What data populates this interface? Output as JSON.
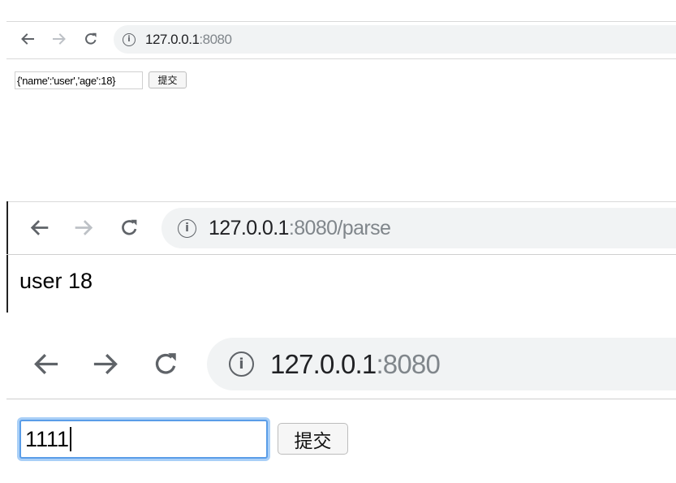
{
  "panel1": {
    "url_host": "127.0.0.1",
    "url_rest": ":8080",
    "input_value": "{'name':'user','age':18}",
    "submit_label": "提交"
  },
  "panel2": {
    "url_host": "127.0.0.1",
    "url_rest": ":8080/parse",
    "response_text": "user 18"
  },
  "panel3": {
    "url_host": "127.0.0.1",
    "url_rest": ":8080",
    "input_value": "1111",
    "submit_label": "提交"
  },
  "icons": {
    "back": "back-arrow-icon",
    "forward": "forward-arrow-icon",
    "reload": "reload-icon",
    "info": "info-icon"
  },
  "colors": {
    "omnibox_bg": "#f1f3f4",
    "focus_ring": "#6fb0f4",
    "divider": "#d9d9d9"
  }
}
